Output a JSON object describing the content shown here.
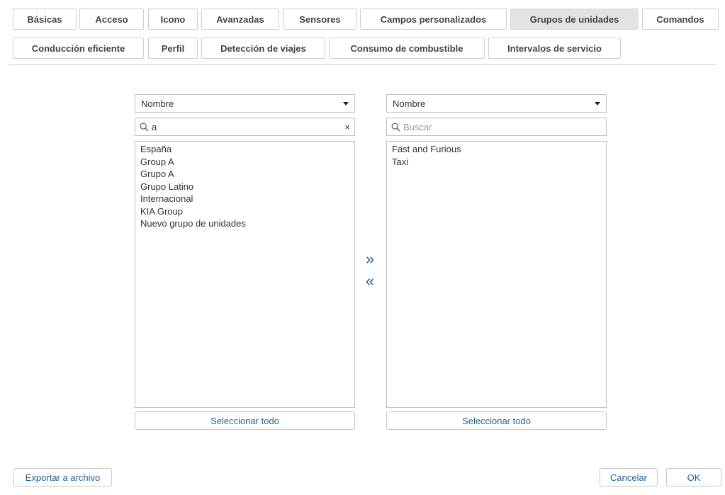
{
  "tabs": {
    "row1": [
      "Básicas",
      "Acceso",
      "Icono",
      "Avanzadas",
      "Sensores",
      "Campos personalizados",
      "Grupos de unidades",
      "Comandos"
    ],
    "row2": [
      "Conducción eficiente",
      "Perfil",
      "Detección de viajes",
      "Consumo de combustible",
      "Intervalos de servicio"
    ],
    "active": "Grupos de unidades"
  },
  "left_panel": {
    "sort_label": "Nombre",
    "search_value": "a",
    "clear_symbol": "×",
    "items": [
      "España",
      "Group A",
      "Grupo A",
      "Grupo Latino",
      "Internacional",
      "KIA Group",
      "Nuevo grupo de unidades"
    ],
    "select_all": "Seleccionar todo"
  },
  "right_panel": {
    "sort_label": "Nombre",
    "search_placeholder": "Buscar",
    "items": [
      "Fast and Furious",
      "Taxi"
    ],
    "select_all": "Seleccionar todo"
  },
  "transfer": {
    "add": "»",
    "remove": "«"
  },
  "footer": {
    "export": "Exportar a archivo",
    "cancel": "Cancelar",
    "ok": "OK"
  },
  "icons": {
    "search": "search-icon",
    "dropdown": "chevron-down-icon"
  }
}
